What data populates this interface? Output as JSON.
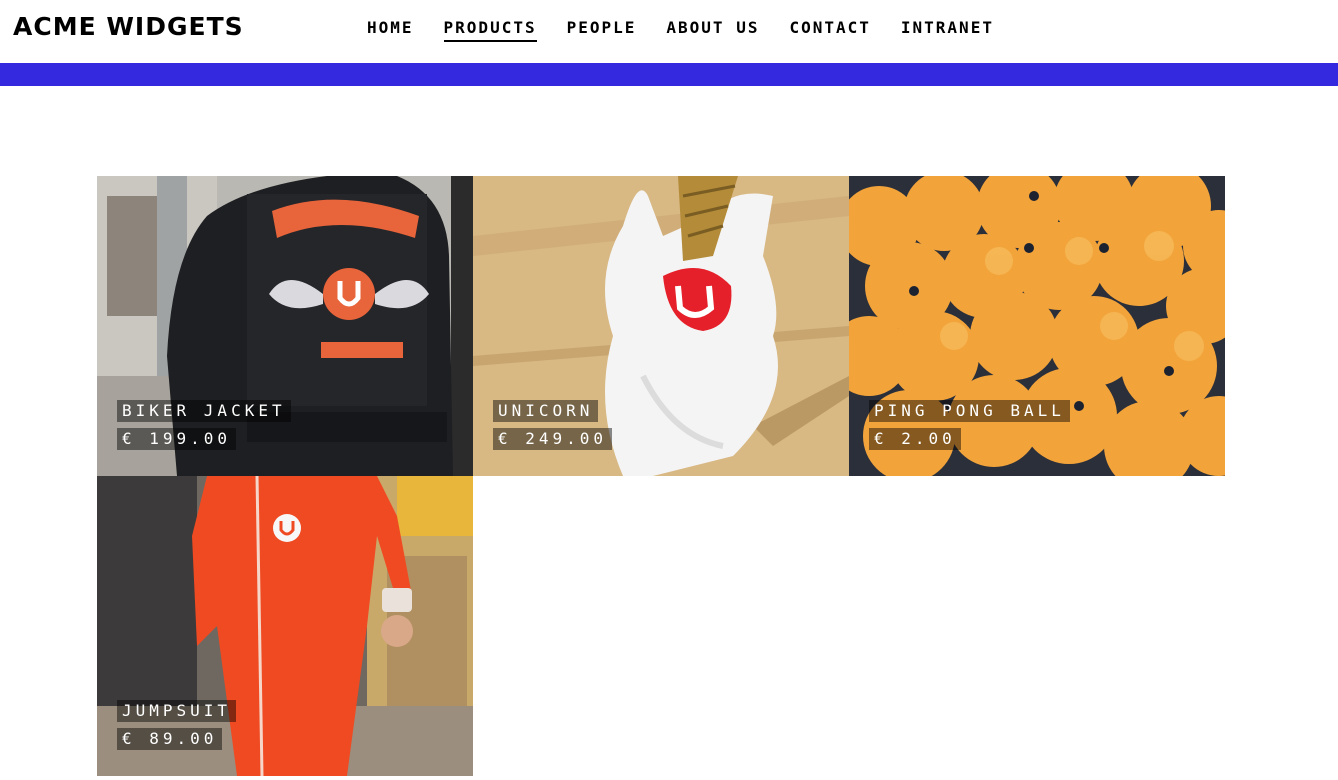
{
  "site": {
    "title": "ACME WIDGETS"
  },
  "nav": {
    "items": [
      {
        "label": "HOME",
        "active": false
      },
      {
        "label": "PRODUCTS",
        "active": true
      },
      {
        "label": "PEOPLE",
        "active": false
      },
      {
        "label": "ABOUT US",
        "active": false
      },
      {
        "label": "CONTACT",
        "active": false
      },
      {
        "label": "INTRANET",
        "active": false
      }
    ]
  },
  "colors": {
    "accent": "#3529df",
    "text": "#000000",
    "overlay": "rgba(0,0,0,0.45)"
  },
  "products": [
    {
      "name": "BIKER JACKET",
      "price": "€ 199.00",
      "image": "leather-jacket-photo"
    },
    {
      "name": "UNICORN",
      "price": "€ 249.00",
      "image": "unicorn-head-photo"
    },
    {
      "name": "PING PONG BALL",
      "price": "€ 2.00",
      "image": "ping-pong-balls-photo"
    },
    {
      "name": "JUMPSUIT",
      "price": "€ 89.00",
      "image": "red-jumpsuit-photo"
    }
  ]
}
